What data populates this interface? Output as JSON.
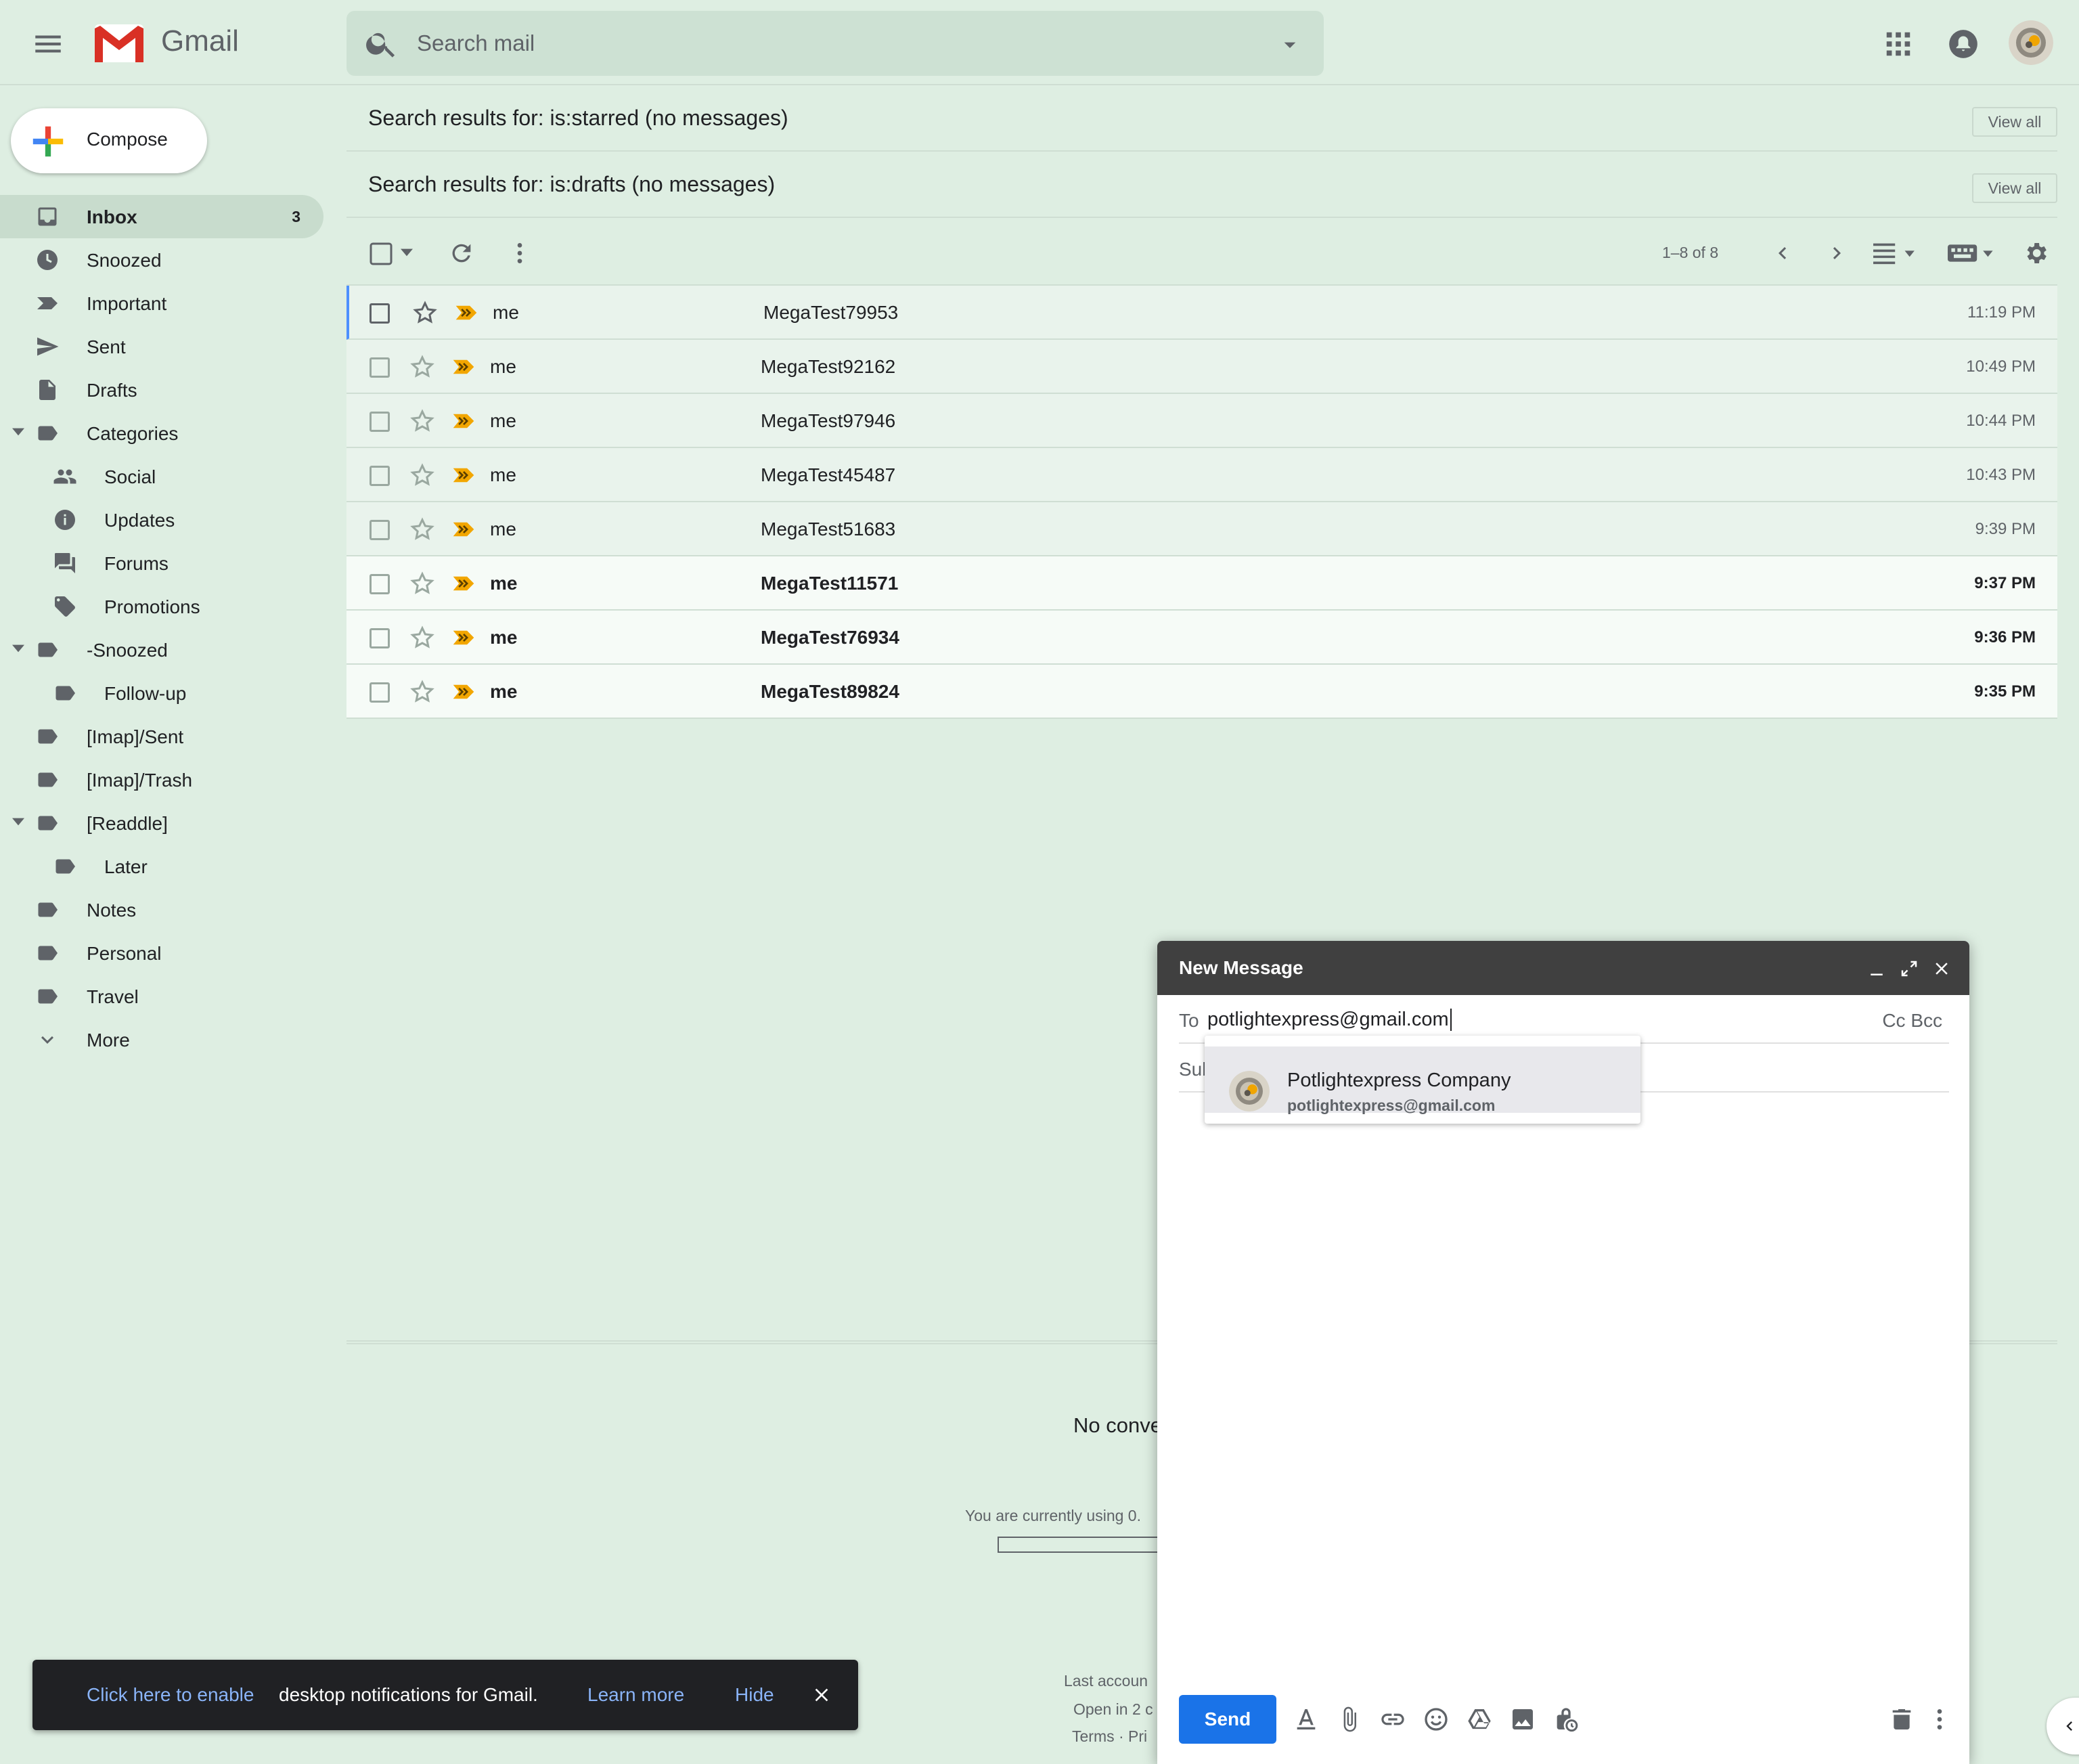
{
  "app": {
    "brand": "Gmail",
    "search_placeholder": "Search mail"
  },
  "compose_button": {
    "label": "Compose"
  },
  "sidebar": {
    "items": [
      {
        "label": "Inbox",
        "count": "3",
        "icon": "inbox-icon",
        "active": true
      },
      {
        "label": "Snoozed",
        "icon": "clock-icon"
      },
      {
        "label": "Important",
        "icon": "important-icon"
      },
      {
        "label": "Sent",
        "icon": "send-icon"
      },
      {
        "label": "Drafts",
        "icon": "draft-icon"
      },
      {
        "label": "Categories",
        "icon": "label-icon",
        "expanded": true
      },
      {
        "label": "Social",
        "icon": "people-icon"
      },
      {
        "label": "Updates",
        "icon": "info-icon"
      },
      {
        "label": "Forums",
        "icon": "forum-icon"
      },
      {
        "label": "Promotions",
        "icon": "tag-icon"
      },
      {
        "label": "-Snoozed",
        "icon": "label-icon",
        "expanded": true
      },
      {
        "label": "Follow-up",
        "icon": "label-icon"
      },
      {
        "label": "[Imap]/Sent",
        "icon": "label-icon"
      },
      {
        "label": "[Imap]/Trash",
        "icon": "label-icon"
      },
      {
        "label": "[Readdle]",
        "icon": "label-icon",
        "expanded": true
      },
      {
        "label": "Later",
        "icon": "label-icon"
      },
      {
        "label": "Notes",
        "icon": "label-icon"
      },
      {
        "label": "Personal",
        "icon": "label-icon"
      },
      {
        "label": "Travel",
        "icon": "label-icon"
      },
      {
        "label": "More",
        "icon": "chevron-down-icon"
      }
    ]
  },
  "sections": [
    {
      "title": "Search results for: is:starred (no messages)",
      "view_all": "View all"
    },
    {
      "title": "Search results for: is:drafts (no messages)",
      "view_all": "View all"
    }
  ],
  "toolbar": {
    "page_info": "1–8 of 8"
  },
  "emails": [
    {
      "sender": "me",
      "subject": "MegaTest79953",
      "time": "11:19 PM",
      "unread": false
    },
    {
      "sender": "me",
      "subject": "MegaTest92162",
      "time": "10:49 PM",
      "unread": false
    },
    {
      "sender": "me",
      "subject": "MegaTest97946",
      "time": "10:44 PM",
      "unread": false
    },
    {
      "sender": "me",
      "subject": "MegaTest45487",
      "time": "10:43 PM",
      "unread": false
    },
    {
      "sender": "me",
      "subject": "MegaTest51683",
      "time": "9:39 PM",
      "unread": false
    },
    {
      "sender": "me",
      "subject": "MegaTest11571",
      "time": "9:37 PM",
      "unread": true
    },
    {
      "sender": "me",
      "subject": "MegaTest76934",
      "time": "9:36 PM",
      "unread": true
    },
    {
      "sender": "me",
      "subject": "MegaTest89824",
      "time": "9:35 PM",
      "unread": true
    }
  ],
  "footer": {
    "no_conversations": "No conve",
    "usage": "You are currently using 0.",
    "last_activity": "Last accoun",
    "open_in": "Open in 2 c",
    "terms": "Terms · Pri"
  },
  "compose_window": {
    "title": "New Message",
    "to_label": "To",
    "to_value": "potlightexpress@gmail.com",
    "cc_bcc": "Cc Bcc",
    "subject_label": "Sub",
    "suggestion": {
      "name": "Potlightexpress Company",
      "email": "potlightexpress@gmail.com"
    },
    "send_label": "Send"
  },
  "notification": {
    "enable_link": "Click here to enable",
    "message": "desktop notifications for Gmail.",
    "learn_more": "Learn more",
    "hide": "Hide"
  },
  "colors": {
    "background": "#deeee2",
    "accent": "#1a73e8",
    "compose_header": "#404040",
    "important_marker": "#f2a600"
  }
}
